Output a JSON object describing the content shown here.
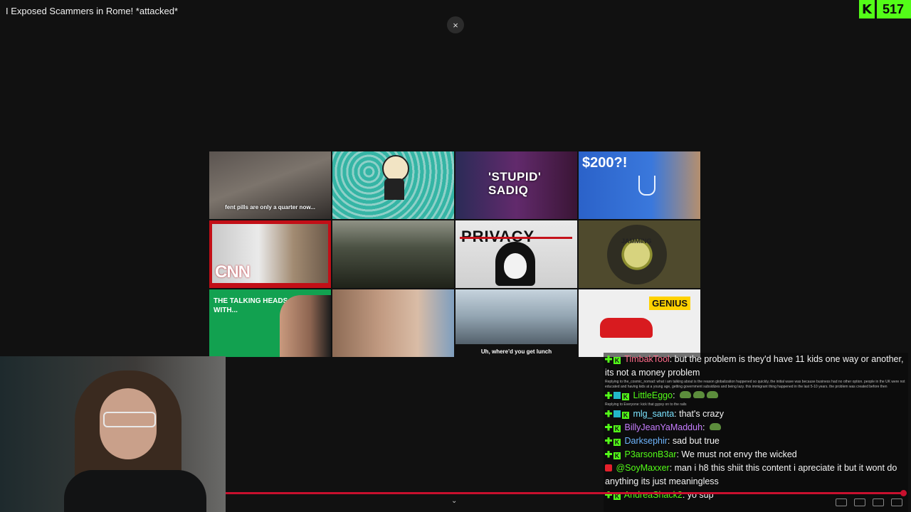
{
  "video": {
    "title": "I Exposed Scammers in Rome! *attacked*",
    "close_icon": "×",
    "bottom_chevron": "⌄"
  },
  "viewer_badge": {
    "logo": "K",
    "count": "517",
    "color": "#53fc18"
  },
  "thumbnails": [
    {
      "caption": "fent pills are only a quarter now..."
    },
    {
      "caption": ""
    },
    {
      "caption": "'STUPID' SADIQ"
    },
    {
      "caption": "$200?!"
    },
    {
      "caption": "CNN"
    },
    {
      "caption": ""
    },
    {
      "caption": "PRIVACY"
    },
    {
      "caption": "JAMMING"
    },
    {
      "caption": "THE TALKING HEADS PODCAST WITH..."
    },
    {
      "caption": ""
    },
    {
      "caption": "Uh, where'd you get lunch"
    },
    {
      "caption": "GENIUS"
    }
  ],
  "chat": {
    "messages": [
      {
        "user": "TimbakTool",
        "color": "#ff6b8a",
        "text": ": but the problem is they'd have 11 kids one way or another, its not a money problem"
      },
      {
        "reply": "Replying to the_cosmic_nomad: what i am talking about is the reason globalization happened so quickly, the initial wave was because business had no other option. people in the UK were not educated and having kids at a young age, getting government subsidizes and being lazy. this immigrant thing happened in the last 5-10 years. the problem was created before then"
      },
      {
        "user": "LittleEggo",
        "color": "#53fc18",
        "text": ":"
      },
      {
        "reply": "Replying to Everyone: kick that gypsy on to the rails"
      },
      {
        "user": "mlg_santa",
        "color": "#7be3ff",
        "text": ": that's crazy"
      },
      {
        "user": "BillyJeanYaMadduh",
        "color": "#c77dff",
        "text": ":"
      },
      {
        "user": "Darksephir",
        "color": "#6fb6ff",
        "text": ": sad but true"
      },
      {
        "user": "P3arsonB3ar",
        "color": "#53fc18",
        "text": ": We must not envy the wicked"
      },
      {
        "user": "@SoyMaxxer",
        "color": "#53fc18",
        "text": ": man i h8 this shiit this content i apreciate it but it wont do anything its just meaningless"
      },
      {
        "user": "AndreaShack2",
        "color": "#53fc18",
        "text": ": yo sup"
      }
    ]
  }
}
